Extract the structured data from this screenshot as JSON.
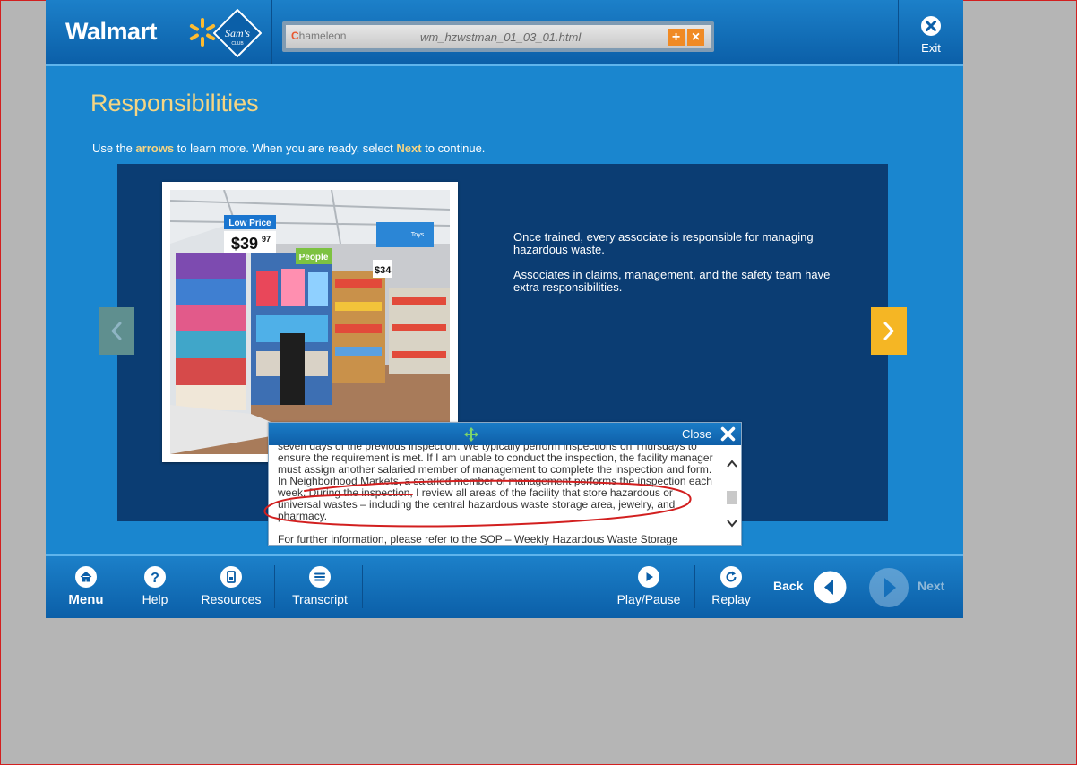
{
  "header": {
    "brand": "Walmart",
    "url_bar": {
      "logo_text": "hameleon",
      "url": "wm_hzwstman_01_03_01.html",
      "plus": "+",
      "close": "×"
    },
    "exit_label": "Exit"
  },
  "page": {
    "title": "Responsibilities",
    "instructions": {
      "part1": "Use the ",
      "arrows": "arrows",
      "part2": " to learn more.  When you are ready, select ",
      "next": "Next",
      "part3": " to continue."
    },
    "panel_text": [
      "Once trained, every associate is responsible for managing hazardous waste.",
      "Associates in claims, management, and the safety team have extra responsibilities."
    ],
    "photo_sign": {
      "low_price": "Low Price",
      "price": "$39",
      "cents": "97",
      "price2": "$34",
      "toys": "Toys",
      "people": "People"
    }
  },
  "footer": {
    "menu": "Menu",
    "help": "Help",
    "resources": "Resources",
    "transcript": "Transcript",
    "play_pause": "Play/Pause",
    "replay": "Replay",
    "back": "Back",
    "next": "Next"
  },
  "transcript_popup": {
    "close_label": "Close",
    "paragraphs": [
      "seven days of the previous inspection.  We typically perform inspections on Thursdays to ensure the requirement is met.  If I am unable to conduct the inspection, the facility manager must assign another salaried member of management to complete the inspection and form.  In Neighborhood Markets, a salaried member of management performs the inspection each week. During the inspection, I review all areas of the facility that store hazardous or universal wastes – including the central hazardous waste storage area, jewelry, and pharmacy.",
      "For further information, please refer to the SOP – Weekly Hazardous Waste Storage"
    ]
  },
  "colors": {
    "brand_blue": "#1a86cf",
    "panel_navy": "#0b3d73",
    "accent_yellow": "#f5b624",
    "title_gold": "#f5d583",
    "annotation_red": "#d21f1f"
  }
}
